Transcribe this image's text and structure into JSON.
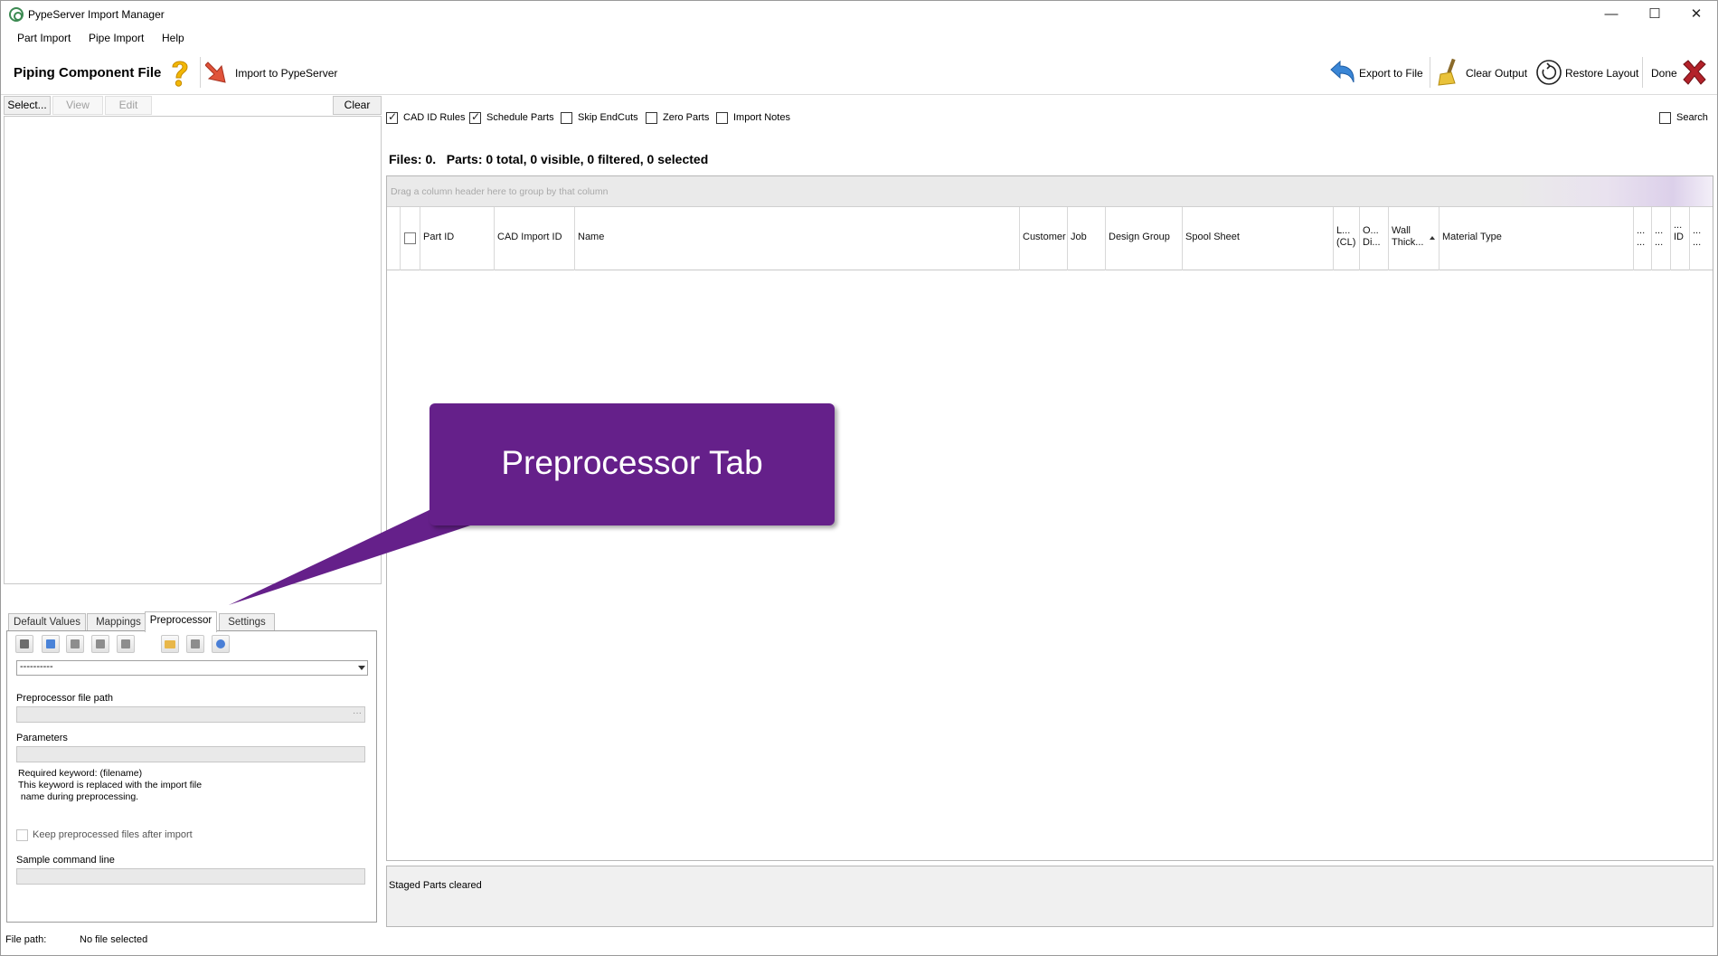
{
  "window": {
    "title": "PypeServer Import Manager",
    "controls": [
      "—",
      "☐",
      "✕"
    ]
  },
  "menu": [
    "Part Import",
    "Pipe Import",
    "Help"
  ],
  "toolbar": {
    "title": "Piping Component File",
    "import_label": "Import to PypeServer",
    "export_label": "Export to File",
    "clear_output_label": "Clear Output",
    "restore_layout_label": "Restore Layout",
    "done_label": "Done"
  },
  "left": {
    "buttons": {
      "select": "Select...",
      "view": "View",
      "edit": "Edit",
      "clear": "Clear"
    },
    "tabs": [
      "Default Values",
      "Mappings",
      "Preprocessor",
      "Settings"
    ],
    "active_tab": "Preprocessor",
    "preprocessor": {
      "combo_value": "----------",
      "file_path_label": "Preprocessor file path",
      "file_path_value": "",
      "file_path_ellipsis": "···",
      "parameters_label": "Parameters",
      "parameters_value": "",
      "note_line1": "Required keyword: (filename)",
      "note_line2": "This keyword  is replaced with the import file",
      "note_line3": " name during preprocessing.",
      "keep_files_label": "Keep preprocessed files after import",
      "keep_files_checked": false,
      "sample_label": "Sample command line",
      "sample_value": ""
    }
  },
  "status": {
    "file_path_label": "File path:",
    "file_path_value": "No file selected"
  },
  "options": {
    "cad_id_rules": {
      "label": "CAD ID Rules",
      "checked": true
    },
    "schedule_parts": {
      "label": "Schedule Parts",
      "checked": true
    },
    "skip_endcuts": {
      "label": "Skip EndCuts",
      "checked": false
    },
    "zero_parts": {
      "label": "Zero Parts",
      "checked": false
    },
    "import_notes": {
      "label": "Import Notes",
      "checked": false
    },
    "search": {
      "label": "Search",
      "checked": false
    }
  },
  "summary": "Files: 0.   Parts: 0 total, 0 visible, 0 filtered, 0 selected",
  "grid": {
    "group_hint": "Drag a column header here to group by that column",
    "columns": {
      "part_id": "Part ID",
      "cad_import_id": "CAD Import ID",
      "name": "Name",
      "customer": "Customer",
      "job": "Job",
      "design_group": "Design Group",
      "spool_sheet": "Spool Sheet",
      "length_1": "L...",
      "length_2": "(CL)",
      "od_1": "O...",
      "od_2": "Di...",
      "wall_1": "Wall",
      "wall_2": "Thick...",
      "material_type": "Material Type",
      "extra_1a": "...",
      "extra_1b": "...",
      "extra_2a": "...",
      "extra_2b": "...",
      "extra_3a": "...",
      "extra_3b": "ID",
      "extra_4a": "...",
      "extra_4b": "..."
    }
  },
  "output": {
    "text": "Staged Parts cleared"
  },
  "callout": {
    "text": "Preprocessor Tab",
    "color": "#65208a"
  },
  "colors": {
    "accent": "#65208a",
    "arrow_orange": "#e0533a",
    "export_blue": "#3a86d6",
    "done_red": "#b3222a"
  }
}
